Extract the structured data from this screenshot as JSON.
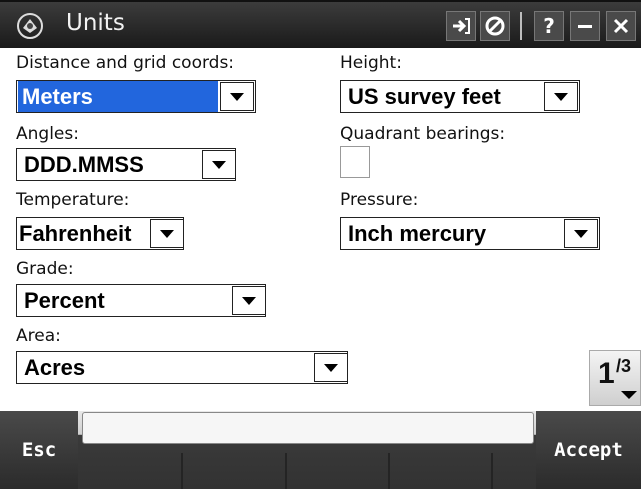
{
  "window": {
    "title": "Units",
    "icon": "app-logo-icon",
    "buttons": [
      {
        "name": "login-icon",
        "glyph": "➔"
      },
      {
        "name": "no-entry-icon",
        "glyph": "⊘"
      },
      {
        "name": "help-icon",
        "glyph": "?"
      },
      {
        "name": "minimize-icon",
        "glyph": "—"
      },
      {
        "name": "close-icon",
        "glyph": "✕"
      }
    ]
  },
  "form": {
    "distance": {
      "label": "Distance and grid coords:",
      "value": "Meters"
    },
    "height": {
      "label": "Height:",
      "value": "US survey feet"
    },
    "angles": {
      "label": "Angles:",
      "value": "DDD.MMSS"
    },
    "quadrant": {
      "label": "Quadrant bearings:",
      "checked": false
    },
    "temperature": {
      "label": "Temperature:",
      "value": "Fahrenheit"
    },
    "pressure": {
      "label": "Pressure:",
      "value": "Inch mercury"
    },
    "grade": {
      "label": "Grade:",
      "value": "Percent"
    },
    "area": {
      "label": "Area:",
      "value": "Acres"
    }
  },
  "pager": {
    "current": "1",
    "total": "/3"
  },
  "softkeys": {
    "esc": "Esc",
    "accept": "Accept"
  },
  "colors": {
    "selection": "#2266dd",
    "titlebar": "#2a2a2a",
    "bottombar": "#333333"
  }
}
